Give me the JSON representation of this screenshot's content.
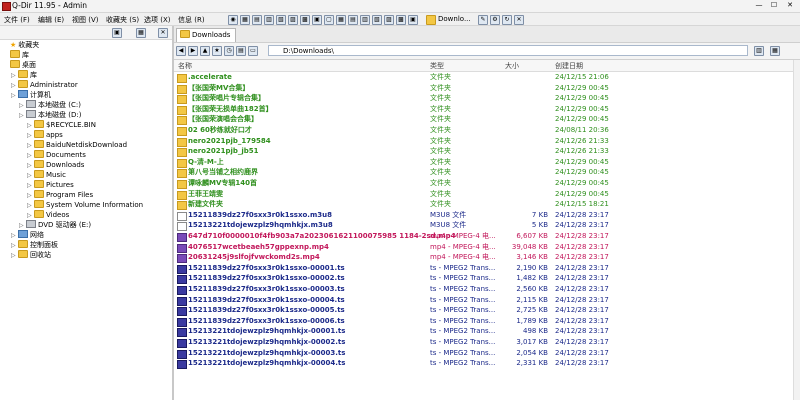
{
  "window": {
    "title": "Q-Dir 11.95 - Admin",
    "min": "—",
    "max": "☐",
    "close": "✕"
  },
  "menu": [
    "文件 (F)",
    "编辑 (E)",
    "视图 (V)",
    "收藏夹 (S)",
    "选项 (X)",
    "信息 (R)"
  ],
  "toolbar": {
    "downloads_label": "Downlo..."
  },
  "tree": [
    {
      "label": "收藏夹",
      "kind": "star",
      "indent": 0
    },
    {
      "label": "库",
      "kind": "folder",
      "indent": 0
    },
    {
      "label": "桌面",
      "kind": "folder",
      "indent": 0
    },
    {
      "label": "库",
      "kind": "folder",
      "indent": 1
    },
    {
      "label": "Administrator",
      "kind": "folder",
      "indent": 1
    },
    {
      "label": "计算机",
      "kind": "pc",
      "indent": 1
    },
    {
      "label": "本地磁盘 (C:)",
      "kind": "drive",
      "indent": 2
    },
    {
      "label": "本地磁盘 (D:)",
      "kind": "drive",
      "indent": 2
    },
    {
      "label": "$RECYCLE.BIN",
      "kind": "folder",
      "indent": 3
    },
    {
      "label": "apps",
      "kind": "folder",
      "indent": 3
    },
    {
      "label": "BaiduNetdiskDownload",
      "kind": "folder",
      "indent": 3
    },
    {
      "label": "Documents",
      "kind": "folder",
      "indent": 3
    },
    {
      "label": "Downloads",
      "kind": "folder",
      "indent": 3
    },
    {
      "label": "Music",
      "kind": "folder",
      "indent": 3
    },
    {
      "label": "Pictures",
      "kind": "folder",
      "indent": 3
    },
    {
      "label": "Program Files",
      "kind": "folder",
      "indent": 3
    },
    {
      "label": "System Volume Information",
      "kind": "folder",
      "indent": 3
    },
    {
      "label": "Videos",
      "kind": "folder",
      "indent": 3
    },
    {
      "label": "DVD 驱动器 (E:)",
      "kind": "drive",
      "indent": 2
    },
    {
      "label": "网络",
      "kind": "pc",
      "indent": 1
    },
    {
      "label": "控制面板",
      "kind": "folder",
      "indent": 1
    },
    {
      "label": "回收站",
      "kind": "folder",
      "indent": 1
    }
  ],
  "tab": {
    "label": "Downloads"
  },
  "address": {
    "path": "D:\\Downloads\\"
  },
  "columns": {
    "name": "名称",
    "type": "类型",
    "size": "大小",
    "date": "创建日期"
  },
  "files": [
    {
      "name": ".accelerate",
      "type": "文件夹",
      "size": "",
      "date": "24/12/15 21:06",
      "kind": "folder",
      "color": "green"
    },
    {
      "name": "【张国荣MV合集】",
      "type": "文件夹",
      "size": "",
      "date": "24/12/29 00:45",
      "kind": "folder",
      "color": "green"
    },
    {
      "name": "【张国荣唱片专辑合集】",
      "type": "文件夹",
      "size": "",
      "date": "24/12/29 00:45",
      "kind": "folder",
      "color": "green"
    },
    {
      "name": "【张国荣无损单曲182首】",
      "type": "文件夹",
      "size": "",
      "date": "24/12/29 00:45",
      "kind": "folder",
      "color": "green"
    },
    {
      "name": "【张国荣演唱会合集】",
      "type": "文件夹",
      "size": "",
      "date": "24/12/29 00:45",
      "kind": "folder",
      "color": "green"
    },
    {
      "name": "02 60秒练就好口才",
      "type": "文件夹",
      "size": "",
      "date": "24/08/11 20:36",
      "kind": "folder",
      "color": "green"
    },
    {
      "name": "nero2021pjb_179584",
      "type": "文件夹",
      "size": "",
      "date": "24/12/26 21:33",
      "kind": "folder",
      "color": "green"
    },
    {
      "name": "nero2021pjb_jb51",
      "type": "文件夹",
      "size": "",
      "date": "24/12/26 21:33",
      "kind": "folder",
      "color": "green"
    },
    {
      "name": "Q-清-M-上",
      "type": "文件夹",
      "size": "",
      "date": "24/12/29 00:45",
      "kind": "folder",
      "color": "green"
    },
    {
      "name": "第八号当铺之相约鹿界",
      "type": "文件夹",
      "size": "",
      "date": "24/12/29 00:45",
      "kind": "folder",
      "color": "green"
    },
    {
      "name": "谭咏麟MV专辑140首",
      "type": "文件夹",
      "size": "",
      "date": "24/12/29 00:45",
      "kind": "folder",
      "color": "green"
    },
    {
      "name": "王菲王靖雯",
      "type": "文件夹",
      "size": "",
      "date": "24/12/29 00:45",
      "kind": "folder",
      "color": "green"
    },
    {
      "name": "新建文件夹",
      "type": "文件夹",
      "size": "",
      "date": "24/12/15 18:21",
      "kind": "folder",
      "color": "green"
    },
    {
      "name": "15211839dz27f0sxx3r0k1ssxo.m3u8",
      "type": "M3U8 文件",
      "size": "7 KB",
      "date": "24/12/28 23:17",
      "kind": "m3u8",
      "color": "navy"
    },
    {
      "name": "15213221tdojewzplz9hqmhkjx.m3u8",
      "type": "M3U8 文件",
      "size": "5 KB",
      "date": "24/12/28 23:17",
      "kind": "m3u8",
      "color": "navy"
    },
    {
      "name": "647d710f0000010f4fb903a7a2023061621100075985 1184-2sd.mp4",
      "type": "mp4 - MPEG-4 电...",
      "size": "6,607 KB",
      "date": "24/12/28 23:17",
      "kind": "mp4",
      "color": "pink"
    },
    {
      "name": "4076517wcetbeaeh57gppexnp.mp4",
      "type": "mp4 - MPEG-4 电...",
      "size": "39,048 KB",
      "date": "24/12/28 23:17",
      "kind": "mp4",
      "color": "pink"
    },
    {
      "name": "20631245j9slfojfvwckomd2s.mp4",
      "type": "mp4 - MPEG-4 电...",
      "size": "3,146 KB",
      "date": "24/12/28 23:17",
      "kind": "mp4",
      "color": "pink"
    },
    {
      "name": "15211839dz27f0sxx3r0k1ssxo-00001.ts",
      "type": "ts - MPEG2 Trans...",
      "size": "2,190 KB",
      "date": "24/12/28 23:17",
      "kind": "ts",
      "color": "navy"
    },
    {
      "name": "15211839dz27f0sxx3r0k1ssxo-00002.ts",
      "type": "ts - MPEG2 Trans...",
      "size": "1,482 KB",
      "date": "24/12/28 23:17",
      "kind": "ts",
      "color": "navy"
    },
    {
      "name": "15211839dz27f0sxx3r0k1ssxo-00003.ts",
      "type": "ts - MPEG2 Trans...",
      "size": "2,560 KB",
      "date": "24/12/28 23:17",
      "kind": "ts",
      "color": "navy"
    },
    {
      "name": "15211839dz27f0sxx3r0k1ssxo-00004.ts",
      "type": "ts - MPEG2 Trans...",
      "size": "2,115 KB",
      "date": "24/12/28 23:17",
      "kind": "ts",
      "color": "navy"
    },
    {
      "name": "15211839dz27f0sxx3r0k1ssxo-00005.ts",
      "type": "ts - MPEG2 Trans...",
      "size": "2,725 KB",
      "date": "24/12/28 23:17",
      "kind": "ts",
      "color": "navy"
    },
    {
      "name": "15211839dz27f0sxx3r0k1ssxo-00006.ts",
      "type": "ts - MPEG2 Trans...",
      "size": "1,789 KB",
      "date": "24/12/28 23:17",
      "kind": "ts",
      "color": "navy"
    },
    {
      "name": "15213221tdojewzplz9hqmhkjx-00001.ts",
      "type": "ts - MPEG2 Trans...",
      "size": "498 KB",
      "date": "24/12/28 23:17",
      "kind": "ts",
      "color": "navy"
    },
    {
      "name": "15213221tdojewzplz9hqmhkjx-00002.ts",
      "type": "ts - MPEG2 Trans...",
      "size": "3,017 KB",
      "date": "24/12/28 23:17",
      "kind": "ts",
      "color": "navy"
    },
    {
      "name": "15213221tdojewzplz9hqmhkjx-00003.ts",
      "type": "ts - MPEG2 Trans...",
      "size": "2,054 KB",
      "date": "24/12/28 23:17",
      "kind": "ts",
      "color": "navy"
    },
    {
      "name": "15213221tdojewzplz9hqmhkjx-00004.ts",
      "type": "ts - MPEG2 Trans...",
      "size": "2,331 KB",
      "date": "24/12/28 23:17",
      "kind": "ts",
      "color": "navy"
    }
  ]
}
